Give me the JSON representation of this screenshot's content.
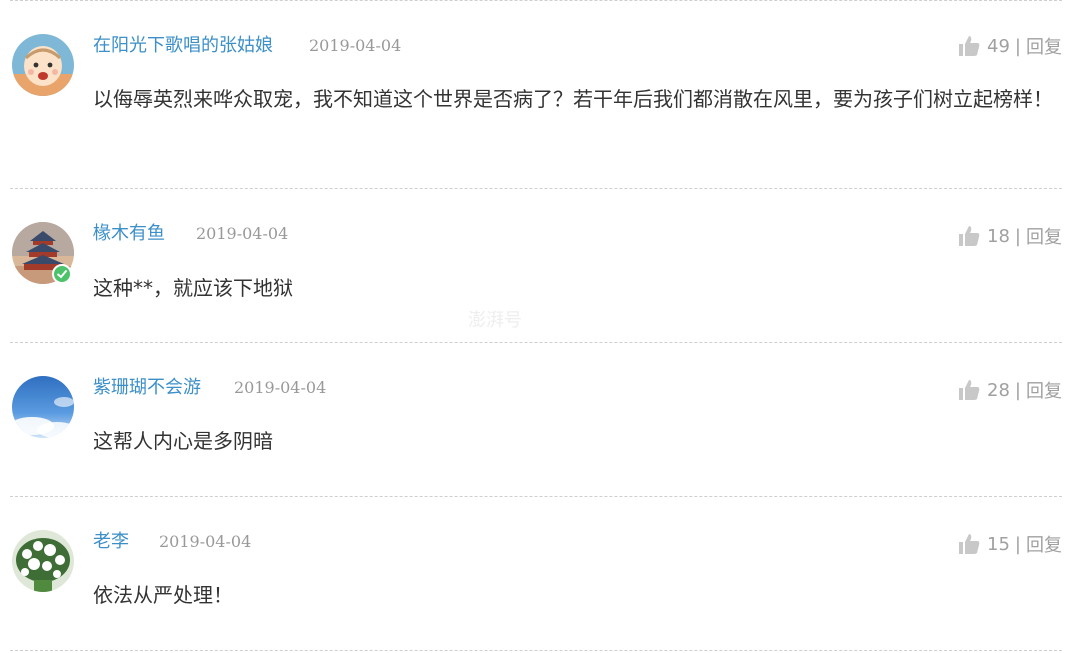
{
  "comments": [
    {
      "username": "在阳光下歌唱的张姑娘",
      "date": "2019-04-04",
      "likes": "49",
      "reply_label": "回复",
      "separator": "|",
      "text": "以侮辱英烈来哗众取宠，我不知道这个世界是否病了？若干年后我们都消散在风里，要为孩子们树立起榜样！",
      "avatar": "cartoon-baby-avatar"
    },
    {
      "username": "椽木有鱼",
      "date": "2019-04-04",
      "likes": "18",
      "reply_label": "回复",
      "separator": "|",
      "text": "这种**，就应该下地狱",
      "avatar": "temple-of-heaven-avatar"
    },
    {
      "username": "紫珊瑚不会游",
      "date": "2019-04-04",
      "likes": "28",
      "reply_label": "回复",
      "separator": "|",
      "text": "这帮人内心是多阴暗",
      "avatar": "blue-sky-avatar"
    },
    {
      "username": "老李",
      "date": "2019-04-04",
      "likes": "15",
      "reply_label": "回复",
      "separator": "|",
      "text": "依法从严处理！",
      "avatar": "white-flower-tree-avatar"
    }
  ],
  "watermark": "澎湃号",
  "colors": {
    "username": "#3d8fc8",
    "meta": "#999999",
    "text": "#333333",
    "divider": "#cfcfcf"
  }
}
